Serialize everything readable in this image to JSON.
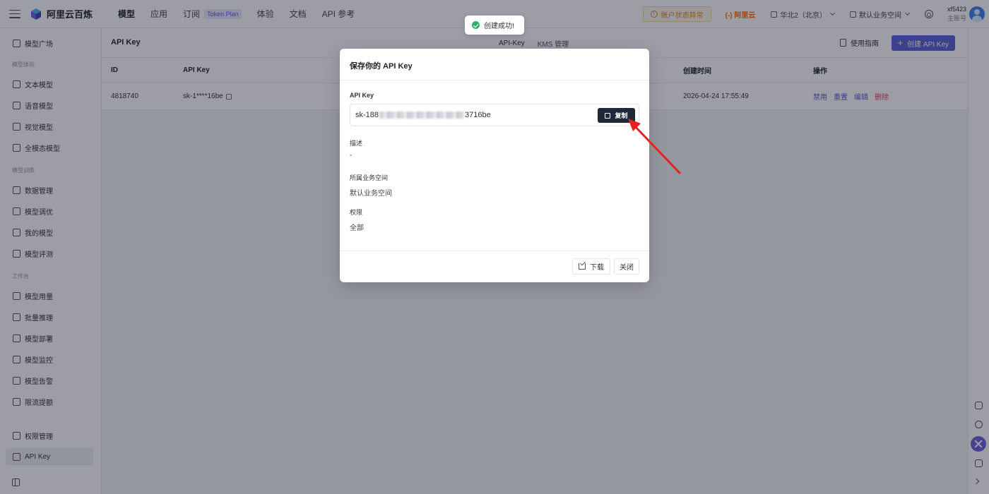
{
  "app": {
    "name": "阿里云百炼"
  },
  "topnav": [
    {
      "label": "模型",
      "active": true
    },
    {
      "label": "应用"
    },
    {
      "label": "订阅",
      "badge": "Token Plan"
    },
    {
      "label": "体验"
    },
    {
      "label": "文档"
    },
    {
      "label": "API 参考"
    }
  ],
  "topright": {
    "account_status": "账户状态异常",
    "aliyun": "(-) 阿里云",
    "region": "华北2（北京）",
    "workspace": "默认业务空间",
    "username": "xf5423",
    "account_type": "主账号"
  },
  "sidebar": {
    "items": [
      {
        "label": "模型广场"
      },
      {
        "group": "模型体验"
      },
      {
        "label": "文本模型"
      },
      {
        "label": "语音模型"
      },
      {
        "label": "视觉模型"
      },
      {
        "label": "全模态模型"
      },
      {
        "group": "模型训练"
      },
      {
        "label": "数据管理"
      },
      {
        "label": "模型调优"
      },
      {
        "label": "我的模型"
      },
      {
        "label": "模型评测"
      },
      {
        "group": "工作台"
      },
      {
        "label": "模型用量"
      },
      {
        "label": "批量推理"
      },
      {
        "label": "模型部署"
      },
      {
        "label": "模型监控"
      },
      {
        "label": "模型告警"
      },
      {
        "label": "限流提额"
      },
      {
        "label": "权限管理"
      },
      {
        "label": "API Key",
        "active": true
      }
    ]
  },
  "page": {
    "title": "API Key",
    "tabs": [
      {
        "label": "API-Key",
        "active": true
      },
      {
        "label": "KMS 管理"
      }
    ],
    "guide_label": "使用指南",
    "create_label": "创建 API Key"
  },
  "table": {
    "columns": {
      "id": "ID",
      "key": "API Key",
      "created": "创建时间",
      "ops": "操作"
    },
    "rows": [
      {
        "id": "4818740",
        "key": "sk-1****16be",
        "created": "2026-04-24 17:55:49"
      }
    ],
    "actions": {
      "disable": "禁用",
      "reset": "重置",
      "edit": "编辑",
      "delete": "删除"
    }
  },
  "toast": {
    "text": "创建成功!"
  },
  "modal": {
    "title": "保存你的 API Key",
    "key_label": "API Key",
    "key_prefix": "sk-188",
    "key_suffix": "3716be",
    "copy_label": "复制",
    "desc_label": "描述",
    "desc_value": "-",
    "workspace_label": "所属业务空间",
    "workspace_value": "默认业务空间",
    "permission_label": "权限",
    "permission_value": "全部",
    "download_label": "下载",
    "close_label": "关闭"
  },
  "colors": {
    "accent": "#5b5fd6",
    "danger": "#e5484d",
    "annotation_arrow": "#e8201e",
    "success": "#2fb06a"
  }
}
